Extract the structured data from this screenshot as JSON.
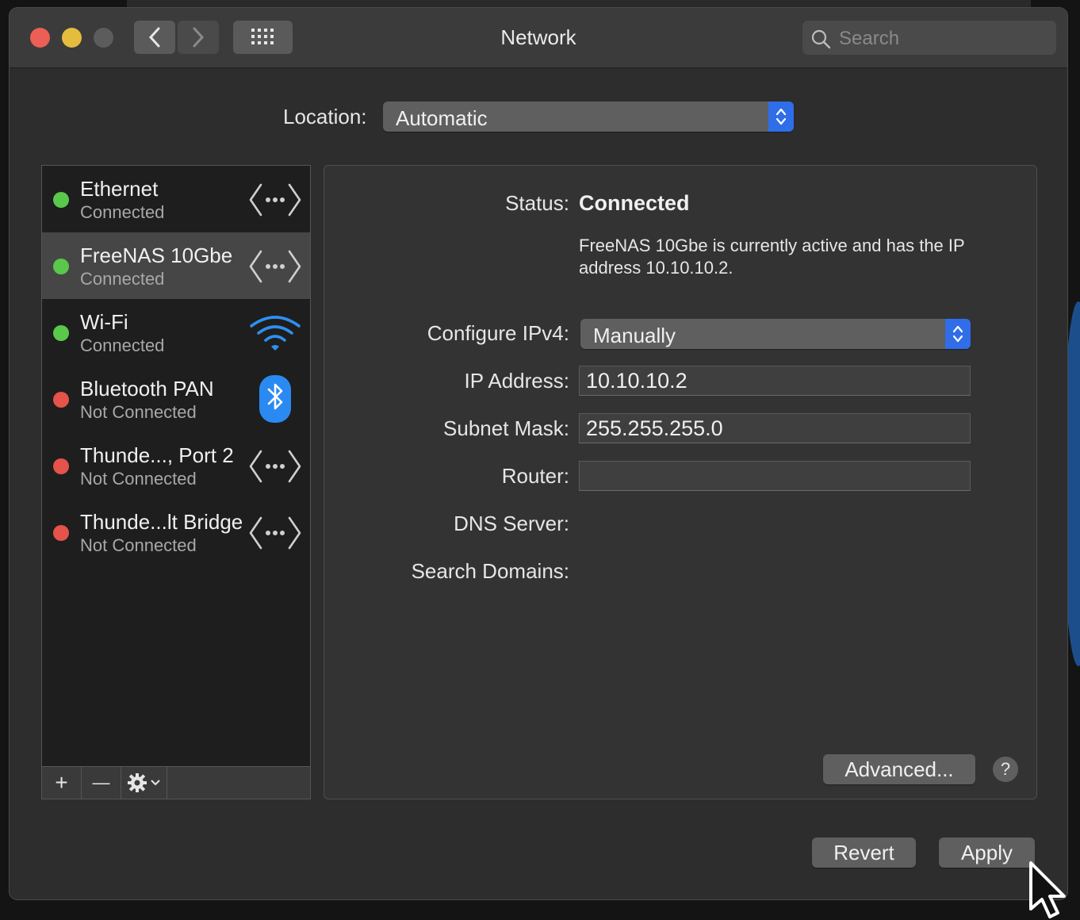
{
  "window": {
    "title": "Network"
  },
  "search": {
    "placeholder": "Search"
  },
  "location": {
    "label": "Location:",
    "value": "Automatic"
  },
  "services": [
    {
      "name": "Ethernet",
      "status": "Connected",
      "status_color": "#5ac84b",
      "icon": "ethernet-icon",
      "selected": false
    },
    {
      "name": "FreeNAS 10Gbe",
      "status": "Connected",
      "status_color": "#5ac84b",
      "icon": "ethernet-icon",
      "selected": true
    },
    {
      "name": "Wi-Fi",
      "status": "Connected",
      "status_color": "#5ac84b",
      "icon": "wifi-icon",
      "selected": false
    },
    {
      "name": "Bluetooth PAN",
      "status": "Not Connected",
      "status_color": "#e5534b",
      "icon": "bluetooth-icon",
      "selected": false
    },
    {
      "name": "Thunde..., Port 2",
      "status": "Not Connected",
      "status_color": "#e5534b",
      "icon": "ethernet-icon",
      "selected": false
    },
    {
      "name": "Thunde...lt Bridge",
      "status": "Not Connected",
      "status_color": "#e5534b",
      "icon": "ethernet-icon",
      "selected": false
    }
  ],
  "sidebar_toolbar": {
    "add": "+",
    "remove": "—"
  },
  "detail": {
    "status_label": "Status:",
    "status_value": "Connected",
    "status_description": "FreeNAS 10Gbe is currently active and has the IP address 10.10.10.2.",
    "configure_label": "Configure IPv4:",
    "configure_value": "Manually",
    "ip_label": "IP Address:",
    "ip_value": "10.10.10.2",
    "subnet_label": "Subnet Mask:",
    "subnet_value": "255.255.255.0",
    "router_label": "Router:",
    "router_value": "",
    "dns_label": "DNS Server:",
    "search_domains_label": "Search Domains:",
    "advanced_label": "Advanced...",
    "help_label": "?"
  },
  "footer": {
    "revert_label": "Revert",
    "apply_label": "Apply"
  },
  "colors": {
    "accent": "#2f6ee8",
    "connected": "#5ac84b",
    "disconnected": "#e5534b"
  }
}
